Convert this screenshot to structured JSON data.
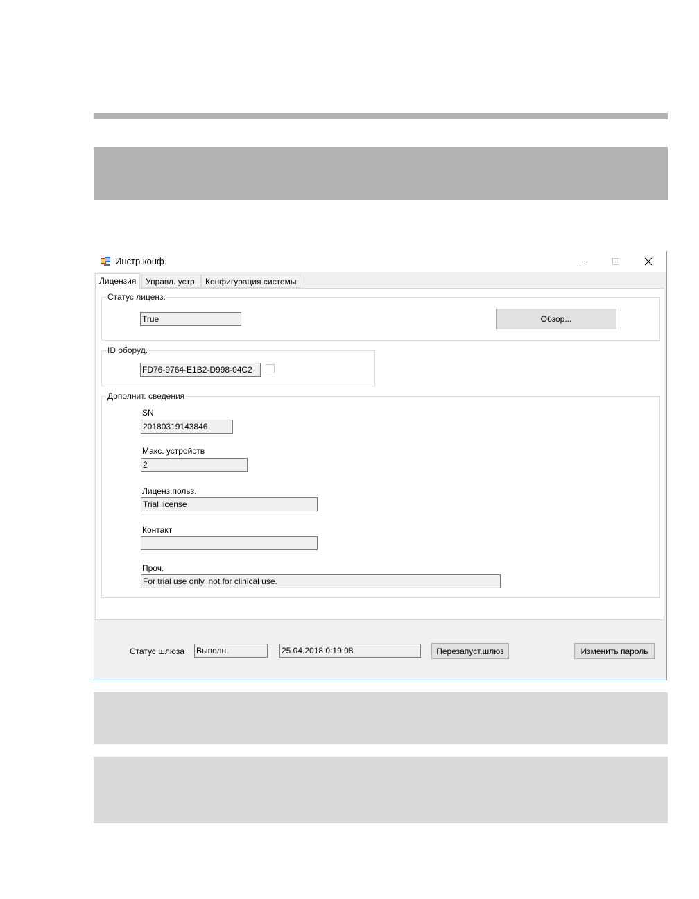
{
  "window": {
    "title": "Инстр.конф.",
    "accent_border": "#6fa6d6"
  },
  "tabs": [
    {
      "label": "Лицензия",
      "selected": true
    },
    {
      "label": "Управл. устр."
    },
    {
      "label": "Конфигурация системы"
    }
  ],
  "license_status": {
    "legend": "Статус лиценз.",
    "value": "True",
    "browse_label": "Обзор..."
  },
  "hardware_id": {
    "legend": "ID оборуд.",
    "value": "FD76-9764-E1B2-D998-04C2",
    "checkbox_checked": false
  },
  "additional_info": {
    "legend": "Дополнит. сведения",
    "sn_label": "SN",
    "sn_value": "20180319143846",
    "max_devices_label": "Макс. устройств",
    "max_devices_value": "2",
    "licensed_user_label": "Лиценз.польз.",
    "licensed_user_value": "Trial license",
    "contact_label": "Контакт",
    "contact_value": "",
    "other_label": "Проч.",
    "other_value": "For trial use only, not for clinical use."
  },
  "gateway": {
    "status_label": "Статус шлюза",
    "status_value": "Выполн.",
    "timestamp": "25.04.2018 0:19:08",
    "restart_label": "Перезапуст.шлюз",
    "change_password_label": "Изменить пароль"
  }
}
